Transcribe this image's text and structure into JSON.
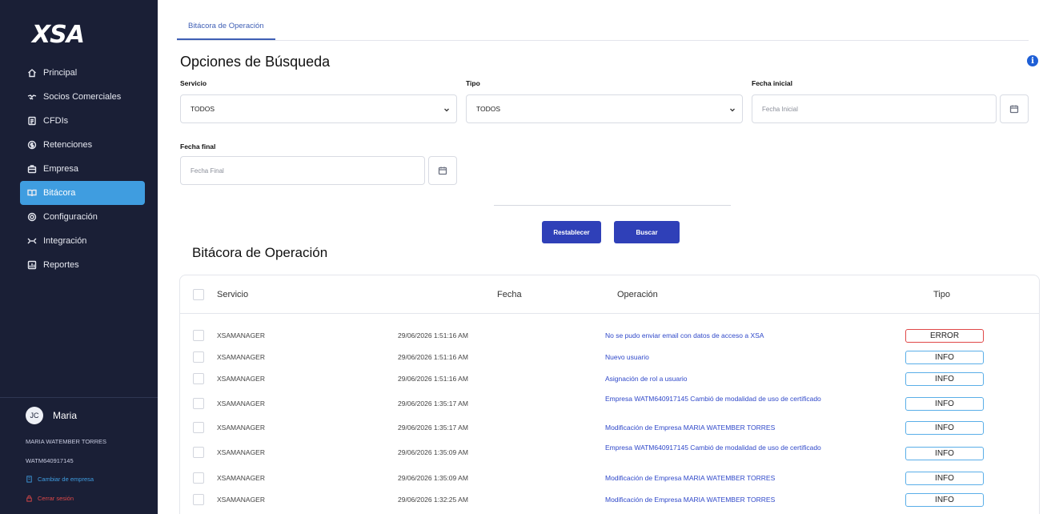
{
  "sidebar": {
    "logo": "XSA",
    "items": [
      {
        "label": "Principal",
        "icon": "home-icon",
        "active": false
      },
      {
        "label": "Socios Comerciales",
        "icon": "handshake-icon",
        "active": false
      },
      {
        "label": "CFDIs",
        "icon": "document-icon",
        "active": false
      },
      {
        "label": "Retenciones",
        "icon": "coin-icon",
        "active": false
      },
      {
        "label": "Empresa",
        "icon": "briefcase-icon",
        "active": false
      },
      {
        "label": "Bitácora",
        "icon": "book-icon",
        "active": true
      },
      {
        "label": "Configuración",
        "icon": "gear-icon",
        "active": false
      },
      {
        "label": "Integración",
        "icon": "integration-icon",
        "active": false
      },
      {
        "label": "Reportes",
        "icon": "chart-icon",
        "active": false
      }
    ],
    "user": {
      "initials": "JC",
      "name": "Maria",
      "full_name": "MARIA WATEMBER TORRES",
      "rfc": "WATM640917145",
      "change_company": "Cambiar de empresa",
      "logout": "Cerrar sesión"
    },
    "colors": {
      "bg": "#1a1f36",
      "active": "#3f9de0",
      "change_company": "#3f9de0",
      "logout": "#e04848"
    }
  },
  "header": {
    "tab": "Bitácora de Operación"
  },
  "search": {
    "title": "Opciones de Búsqueda",
    "servicio": {
      "label": "Servicio",
      "value": "TODOS"
    },
    "tipo": {
      "label": "Tipo",
      "value": "TODOS"
    },
    "fecha_inicial": {
      "label": "Fecha inicial",
      "placeholder": "Fecha Inicial"
    },
    "fecha_final": {
      "label": "Fecha final",
      "placeholder": "Fecha Final"
    },
    "reset_label": "Restablecer",
    "search_label": "Buscar"
  },
  "log": {
    "title": "Bitácora de Operación",
    "columns": {
      "servicio": "Servicio",
      "fecha": "Fecha",
      "operacion": "Operación",
      "tipo": "Tipo"
    },
    "rows": [
      {
        "servicio": "XSAMANAGER",
        "fecha": "29/06/2026 1:51:16 AM",
        "operacion": "No se pudo enviar email con datos de acceso a XSA",
        "tipo": "ERROR"
      },
      {
        "servicio": "XSAMANAGER",
        "fecha": "29/06/2026 1:51:16 AM",
        "operacion": "Nuevo usuario",
        "tipo": "INFO"
      },
      {
        "servicio": "XSAMANAGER",
        "fecha": "29/06/2026 1:51:16 AM",
        "operacion": "Asignación de rol a usuario",
        "tipo": "INFO"
      },
      {
        "servicio": "XSAMANAGER",
        "fecha": "29/06/2026 1:35:17 AM",
        "operacion": "Empresa WATM640917145 Cambió de modalidad de uso de certificado",
        "tipo": "INFO"
      },
      {
        "servicio": "XSAMANAGER",
        "fecha": "29/06/2026 1:35:17 AM",
        "operacion": "Modificación de Empresa MARIA WATEMBER TORRES",
        "tipo": "INFO"
      },
      {
        "servicio": "XSAMANAGER",
        "fecha": "29/06/2026 1:35:09 AM",
        "operacion": "Empresa WATM640917145 Cambió de modalidad de uso de certificado",
        "tipo": "INFO"
      },
      {
        "servicio": "XSAMANAGER",
        "fecha": "29/06/2026 1:35:09 AM",
        "operacion": "Modificación de Empresa MARIA WATEMBER TORRES",
        "tipo": "INFO"
      },
      {
        "servicio": "XSAMANAGER",
        "fecha": "29/06/2026 1:32:25 AM",
        "operacion": "Modificación de Empresa MARIA WATEMBER TORRES",
        "tipo": "INFO"
      }
    ]
  }
}
